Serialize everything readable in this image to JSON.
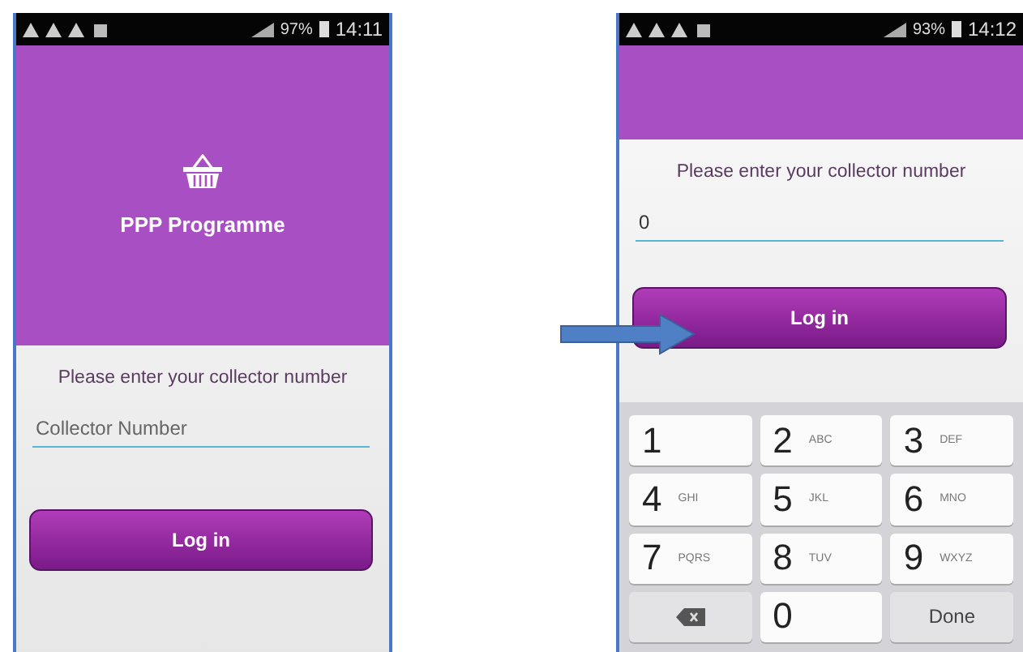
{
  "screens": [
    {
      "status_bar": {
        "battery": "97%",
        "time": "14:11"
      },
      "header": {
        "title": "PPP Programme"
      },
      "prompt": "Please enter your collector number",
      "field": {
        "placeholder": "Collector Number"
      },
      "button": "Log in"
    },
    {
      "status_bar": {
        "battery": "93%",
        "time": "14:12"
      },
      "prompt": "Please enter your collector number",
      "field": {
        "value": "0"
      },
      "button": "Log in",
      "keyboard": {
        "keys": [
          {
            "kind": "digit",
            "label": "1"
          },
          {
            "kind": "digit",
            "label": "2",
            "letters": "ABC"
          },
          {
            "kind": "digit",
            "label": "3",
            "letters": "DEF"
          },
          {
            "kind": "digit",
            "label": "4",
            "letters": "GHI"
          },
          {
            "kind": "digit",
            "label": "5",
            "letters": "JKL"
          },
          {
            "kind": "digit",
            "label": "6",
            "letters": "MNO"
          },
          {
            "kind": "digit",
            "label": "7",
            "letters": "PQRS"
          },
          {
            "kind": "digit",
            "label": "8",
            "letters": "TUV"
          },
          {
            "kind": "digit",
            "label": "9",
            "letters": "WXYZ"
          },
          {
            "kind": "backspace"
          },
          {
            "kind": "digit",
            "label": "0"
          },
          {
            "kind": "done",
            "label": "Done"
          }
        ]
      }
    }
  ]
}
